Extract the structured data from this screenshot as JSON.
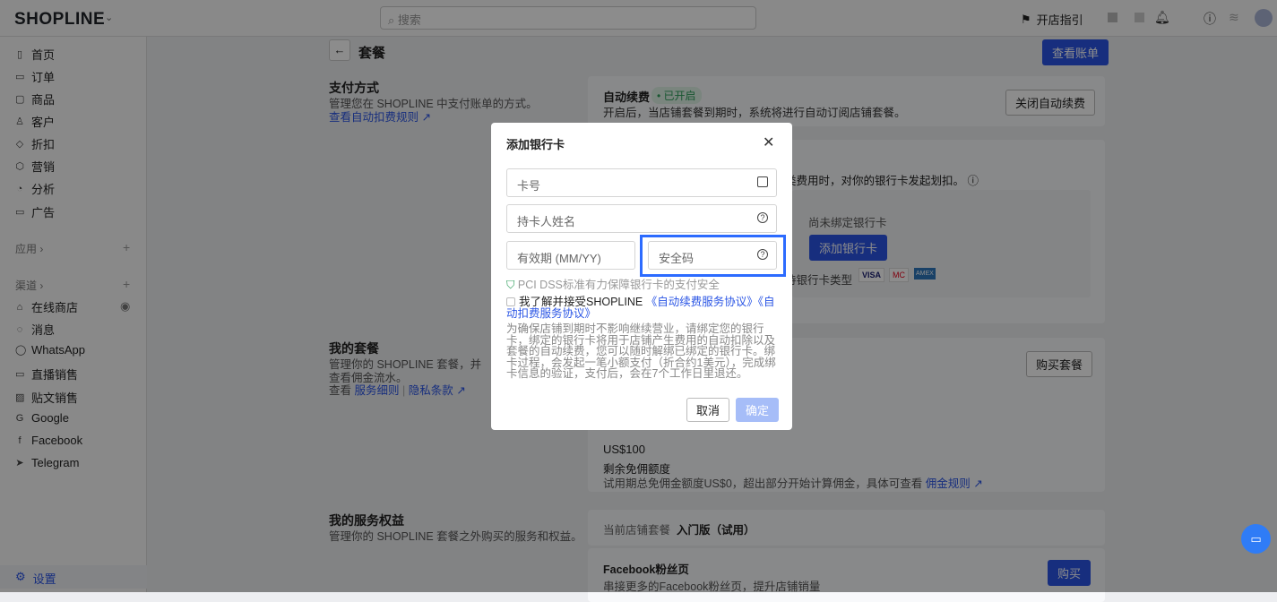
{
  "topbar": {
    "logo": "SHOPLINE",
    "search_placeholder": "搜索",
    "guide": "开店指引"
  },
  "sidebar": {
    "items": [
      {
        "label": "首页",
        "icon": "▯"
      },
      {
        "label": "订单",
        "icon": "▭"
      },
      {
        "label": "商品",
        "icon": "▢"
      },
      {
        "label": "客户",
        "icon": "♙"
      },
      {
        "label": "折扣",
        "icon": "◇"
      },
      {
        "label": "营销",
        "icon": "⬡"
      },
      {
        "label": "分析",
        "icon": "◔"
      },
      {
        "label": "广告",
        "icon": "▭"
      }
    ],
    "apps_label": "应用 ›",
    "channels_label": "渠道 ›",
    "channels": [
      {
        "label": "在线商店",
        "icon": "⌂"
      },
      {
        "label": "消息",
        "icon": "◌"
      },
      {
        "label": "WhatsApp",
        "icon": "◯"
      },
      {
        "label": "直播销售",
        "icon": "▭"
      },
      {
        "label": "贴文销售",
        "icon": "▨"
      },
      {
        "label": "Google",
        "icon": "G"
      },
      {
        "label": "Facebook",
        "icon": "f"
      },
      {
        "label": "Telegram",
        "icon": "➤"
      }
    ],
    "settings": "设置"
  },
  "page": {
    "title": "套餐",
    "view_bill": "查看账单",
    "payment": {
      "title": "支付方式",
      "desc": "管理您在 SHOPLINE 中支付账单的方式。",
      "link": "查看自动扣费规则"
    },
    "auto_renew": {
      "title": "自动续费",
      "badge": "已开启",
      "desc": "开启后，当店铺套餐到期时，系统将进行自动订阅店铺套餐。",
      "button": "关闭自动续费"
    },
    "card_section": {
      "desc": "类费用时，对你的银行卡发起划扣。",
      "no_card": "尚未绑定银行卡",
      "add_card": "添加银行卡",
      "supported": "持银行卡类型",
      "brands": [
        "VISA",
        "MC",
        "AMEX"
      ]
    },
    "plan": {
      "title": "我的套餐",
      "desc": "管理你的 SHOPLINE 套餐，并查看佣金流水。",
      "view": "查看",
      "terms": "服务细则",
      "privacy": "隐私条款",
      "buy": "购买套餐",
      "amount": "US$100",
      "quota_label": "剩余免佣额度",
      "quota_desc": "试用期总免佣金额度US$0，超出部分开始计算佣金，具体可查看",
      "quota_link": "佣金规则"
    },
    "services": {
      "title": "我的服务权益",
      "desc": "管理你的 SHOPLINE 套餐之外购买的服务和权益。",
      "current_label": "当前店铺套餐",
      "current_value": "入门版（试用）",
      "fb_title": "Facebook粉丝页",
      "fb_desc": "串接更多的Facebook粉丝页，提升店铺销量",
      "buy": "购买"
    }
  },
  "modal": {
    "title": "添加银行卡",
    "card_number": "卡号",
    "holder": "持卡人姓名",
    "expiry": "有效期 (MM/YY)",
    "cvv": "安全码",
    "pci": "PCI DSS标准有力保障银行卡的支付安全",
    "agree": "我了解并接受SHOPLINE",
    "agree_link1": "《自动续费服务协议》",
    "agree_link2": "《自动扣费服务协议》",
    "desc": "为确保店铺到期时不影响继续营业，请绑定您的银行卡，绑定的银行卡将用于店铺产生费用的自动扣除以及套餐的自动续费，您可以随时解绑已绑定的银行卡。绑卡过程，会发起一笔小额支付（折合约1美元），完成绑卡信息的验证，支付后，会在7个工作日里退还。",
    "cancel": "取消",
    "confirm": "确定"
  },
  "colors": {
    "accent": "#2a55e5",
    "highlight": "#2c6bff",
    "badge": "#2e9e5b"
  }
}
